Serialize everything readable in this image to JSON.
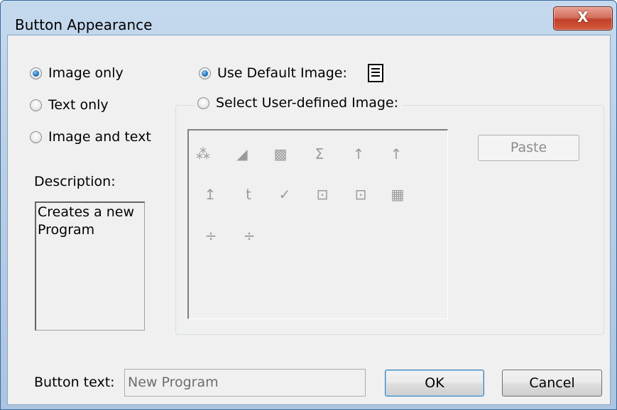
{
  "window": {
    "title": "Button Appearance",
    "close_glyph": "X"
  },
  "display_mode": {
    "options": [
      {
        "label": "Image only",
        "checked": true
      },
      {
        "label": "Text only",
        "checked": false
      },
      {
        "label": "Image and text",
        "checked": false
      }
    ]
  },
  "image_source": {
    "default_label": "Use Default Image:",
    "default_checked": true,
    "user_label": "Select User-defined Image:",
    "user_checked": false,
    "default_icon": "new-program-icon"
  },
  "description": {
    "label": "Description:",
    "text": "Creates a new Program"
  },
  "icons": [
    {
      "name": "hierarchy-icon",
      "glyph": "⁂"
    },
    {
      "name": "paint-bucket-icon",
      "glyph": "◢"
    },
    {
      "name": "overlay-icon",
      "glyph": "▩"
    },
    {
      "name": "sigma-icon",
      "glyph": "Σ"
    },
    {
      "name": "sort-up-small-icon",
      "glyph": "↑"
    },
    {
      "name": "sort-up-icon",
      "glyph": "↑"
    },
    {
      "name": "arrow-up-bar-icon",
      "glyph": "↥"
    },
    {
      "name": "arrow-up-t-icon",
      "glyph": "t"
    },
    {
      "name": "spell-check-icon",
      "glyph": "✓"
    },
    {
      "name": "select-frame-icon",
      "glyph": "⊡"
    },
    {
      "name": "select-frame-alt-icon",
      "glyph": "⊡"
    },
    {
      "name": "sort-rn-icon",
      "glyph": "▦"
    },
    {
      "name": "divide-icon",
      "glyph": "÷"
    },
    {
      "name": "divide-alt-icon",
      "glyph": "÷"
    }
  ],
  "paste_button": {
    "label": "Paste",
    "enabled": false
  },
  "button_text": {
    "label": "Button text:",
    "value": "New Program"
  },
  "ok_button": {
    "label": "OK"
  },
  "cancel_button": {
    "label": "Cancel"
  },
  "colors": {
    "titlebar": "#b9cfe7",
    "close_button": "#c1402a",
    "dialog_bg": "#f0f0f0",
    "disabled_text": "#8c8c8c"
  }
}
